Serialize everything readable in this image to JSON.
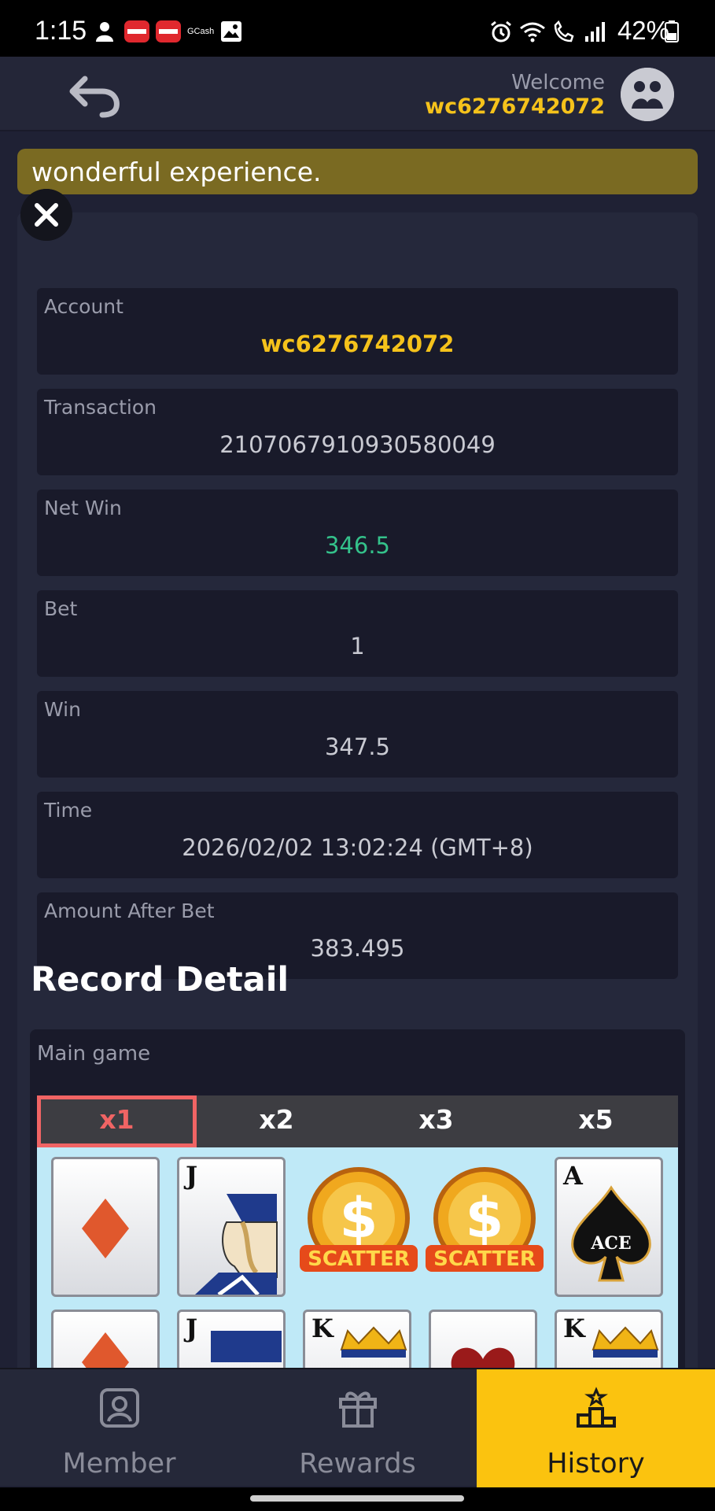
{
  "status_bar": {
    "time": "1:15",
    "right_text": "42%",
    "icons": [
      "user-silhouette-icon",
      "app-icon-red-1",
      "app-icon-red-2",
      "gcash-icon",
      "gallery-icon",
      "alarm-icon",
      "wifi-icon",
      "wifi-call-icon",
      "signal-icon",
      "battery-icon"
    ],
    "gcash_label": "GCash"
  },
  "header": {
    "welcome_label": "Welcome",
    "username": "wc6276742072"
  },
  "marquee": {
    "text": "wonderful experience."
  },
  "fields": [
    {
      "label": "Account",
      "value": "wc6276742072"
    },
    {
      "label": "Transaction",
      "value": "2107067910930580049"
    },
    {
      "label": "Net Win",
      "value": "346.5"
    },
    {
      "label": "Bet",
      "value": "1"
    },
    {
      "label": "Win",
      "value": "347.5"
    },
    {
      "label": "Time",
      "value": "2026/02/02 13:02:24 (GMT+8)"
    },
    {
      "label": "Amount After Bet",
      "value": "383.495"
    }
  ],
  "record_detail": {
    "title": "Record Detail",
    "main_game_label": "Main game",
    "multipliers": [
      "x1",
      "x2",
      "x3",
      "x5"
    ],
    "active_multiplier": "x1",
    "reel_row_1": [
      "diamond-card",
      "J",
      "SCATTER",
      "SCATTER",
      "A"
    ],
    "reel_row_2": [
      "diamond-card",
      "J",
      "K",
      "heart-card",
      "K"
    ],
    "scatter_label": "SCATTER",
    "ace_label": "ACE"
  },
  "bottom_nav": {
    "items": [
      {
        "label": "Member",
        "icon": "member-icon"
      },
      {
        "label": "Rewards",
        "icon": "gift-icon"
      },
      {
        "label": "History",
        "icon": "podium-icon"
      }
    ],
    "active": "History"
  },
  "colors": {
    "accent_gold": "#f5c21b",
    "nav_active": "#fbc30f",
    "net_win_green": "#34c28b",
    "active_tab_red": "#f06464"
  }
}
